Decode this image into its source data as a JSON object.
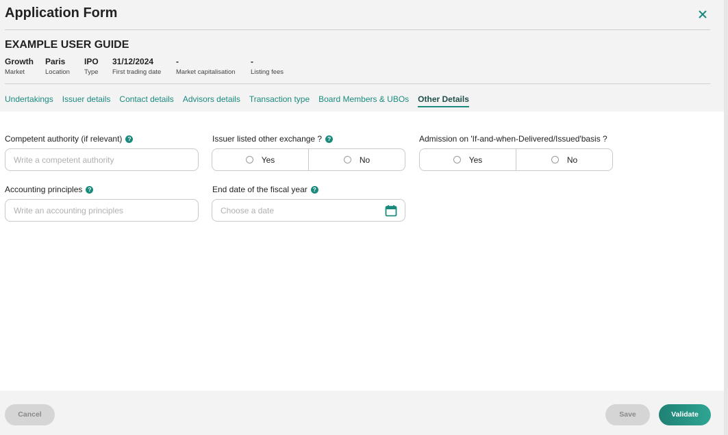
{
  "header": {
    "title": "Application Form",
    "close_icon": "close-icon"
  },
  "guide": {
    "title": "EXAMPLE USER GUIDE",
    "meta": [
      {
        "value": "Growth",
        "label": "Market"
      },
      {
        "value": "Paris",
        "label": "Location"
      },
      {
        "value": "IPO",
        "label": "Type"
      },
      {
        "value": "31/12/2024",
        "label": "First trading date"
      },
      {
        "value": "-",
        "label": "Market capitalisation"
      },
      {
        "value": "-",
        "label": "Listing fees"
      }
    ]
  },
  "tabs": [
    {
      "label": "Undertakings"
    },
    {
      "label": "Issuer details"
    },
    {
      "label": "Contact details"
    },
    {
      "label": "Advisors details"
    },
    {
      "label": "Transaction type"
    },
    {
      "label": "Board Members & UBOs"
    },
    {
      "label": "Other Details",
      "active": true
    }
  ],
  "form": {
    "competent_authority": {
      "label": "Competent authority (if relevant)",
      "placeholder": "Write a competent authority",
      "value": ""
    },
    "issuer_listed": {
      "label": "Issuer listed other exchange ?",
      "options": [
        "Yes",
        "No"
      ],
      "selected": null
    },
    "admission_basis": {
      "label": "Admission on 'If-and-when-Delivered/Issued'basis ?",
      "options": [
        "Yes",
        "No"
      ],
      "selected": null
    },
    "accounting_principles": {
      "label": "Accounting principles",
      "placeholder": "Write an accounting principles",
      "value": ""
    },
    "fiscal_year_end": {
      "label": "End date of the fiscal year",
      "placeholder": "Choose a date",
      "value": ""
    },
    "help_glyph": "?"
  },
  "footer": {
    "cancel_label": "Cancel",
    "save_label": "Save",
    "validate_label": "Validate"
  },
  "colors": {
    "accent": "#1a8a7d",
    "tab_active": "#1f4f48",
    "validate_start": "#1f8174",
    "validate_end": "#2fa593",
    "disabled_button": "#d5d5d5",
    "panel_bg": "#f3f3f3"
  }
}
